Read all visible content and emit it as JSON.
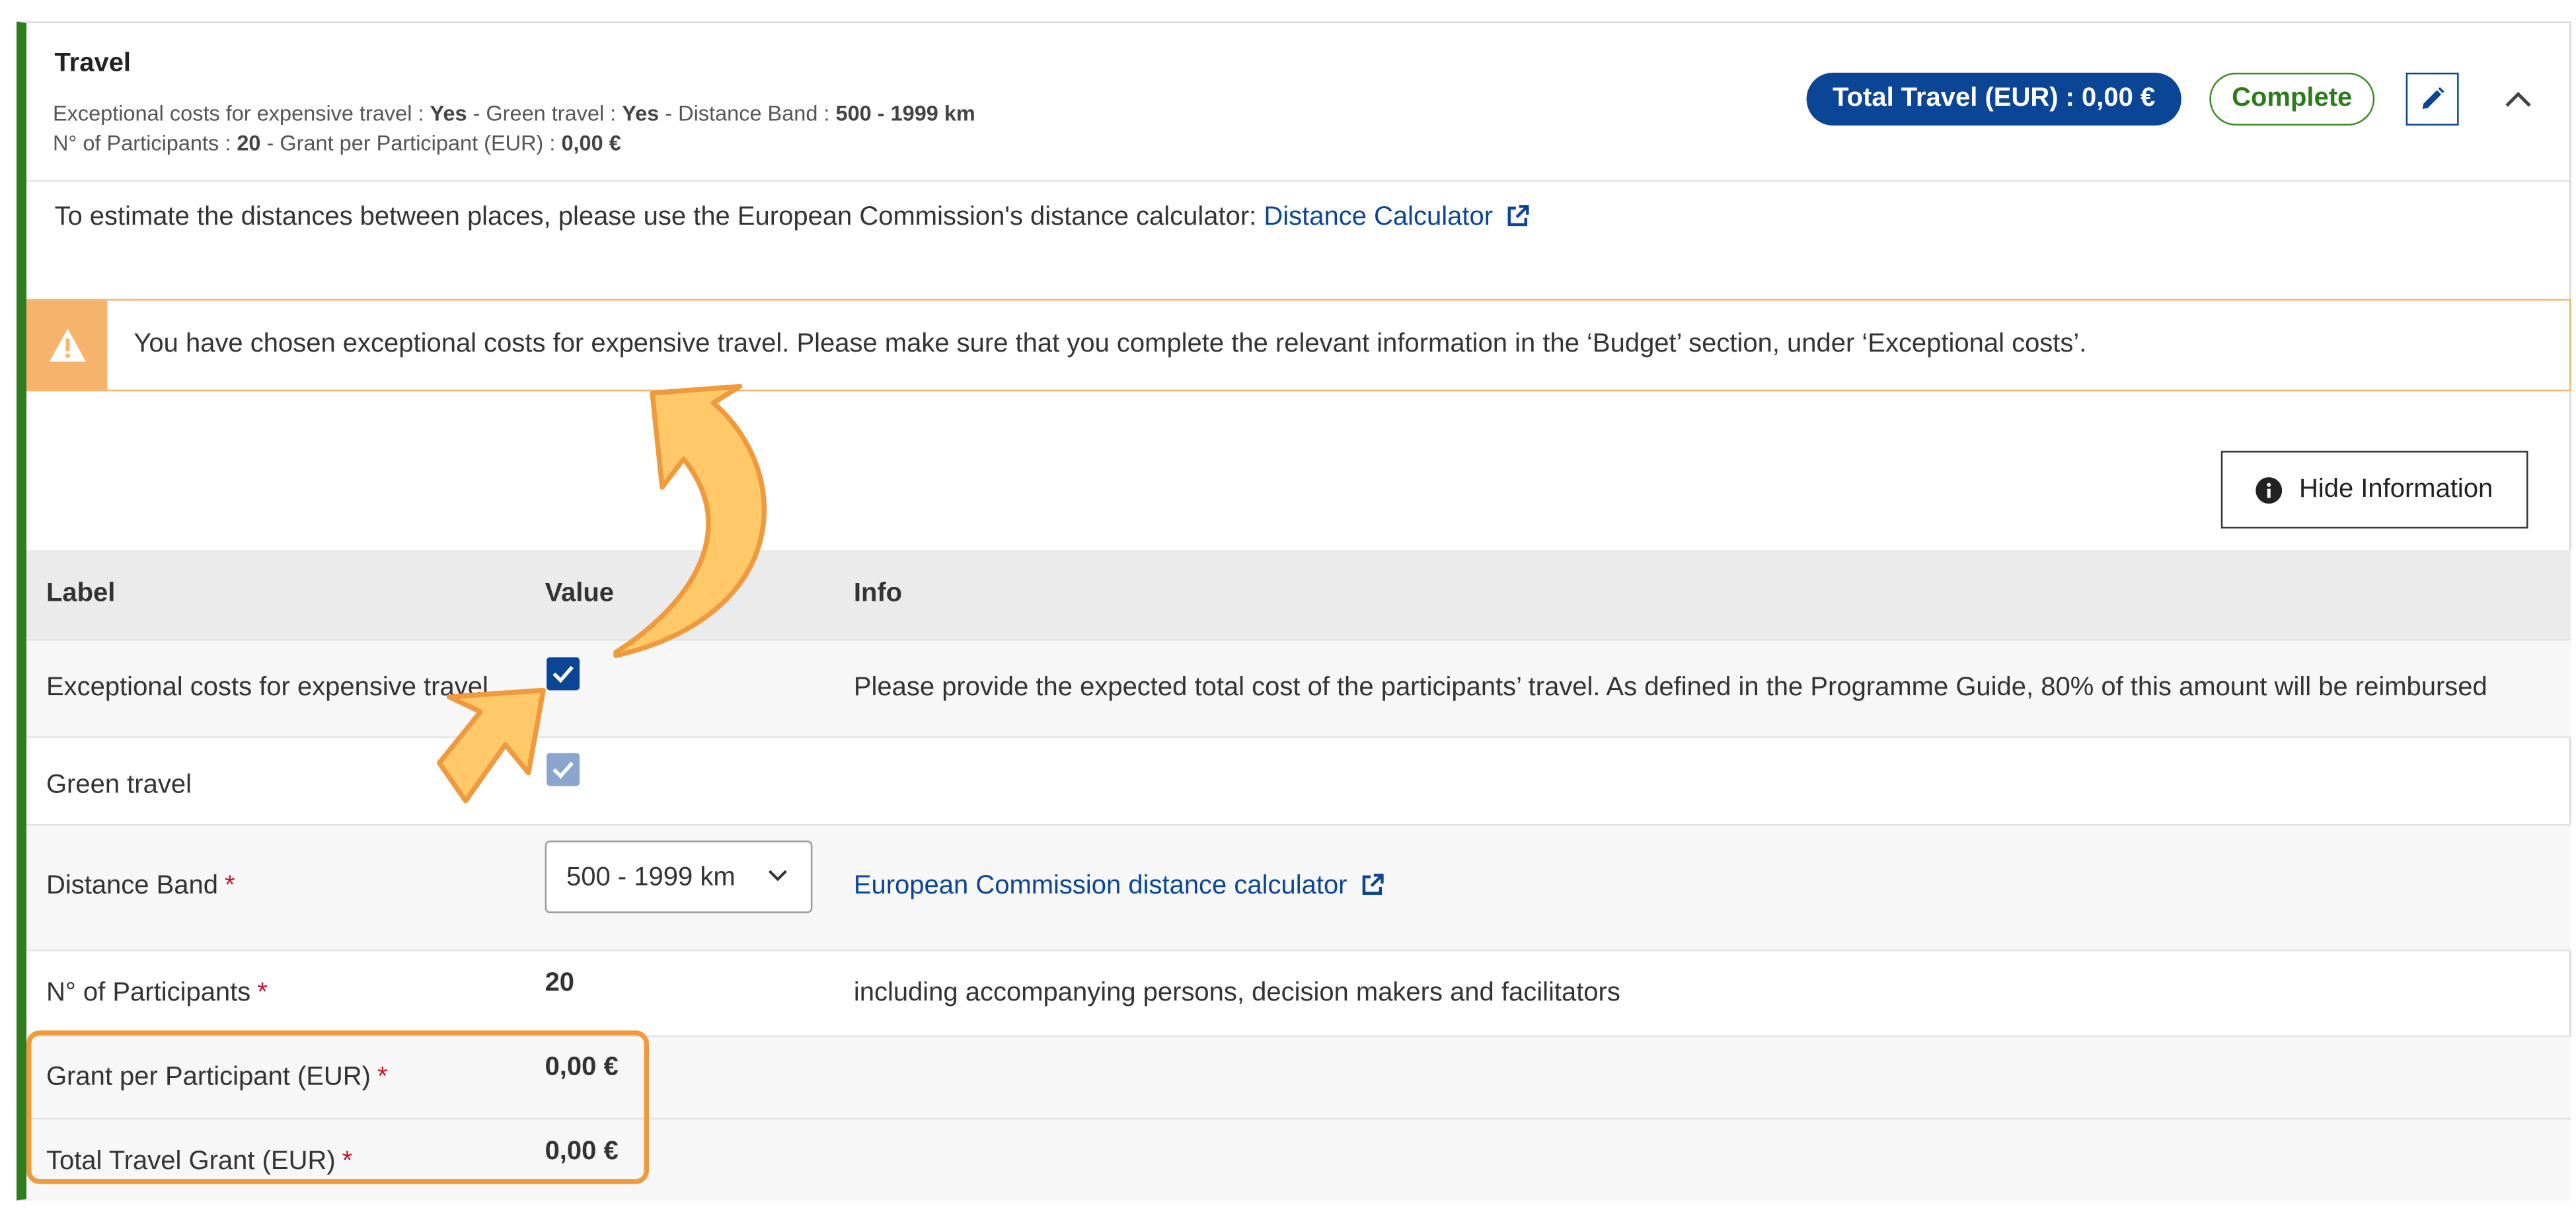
{
  "header": {
    "title": "Travel",
    "summary1": {
      "l1": "Exceptional costs for expensive travel : ",
      "v1": "Yes",
      "l2": " - Green travel : ",
      "v2": "Yes",
      "l3": " - Distance Band : ",
      "v3": "500 - 1999 km"
    },
    "summary2": {
      "l1": "N° of Participants : ",
      "v1": "20",
      "l2": " - Grant per Participant (EUR) : ",
      "v2": "0,00 €"
    },
    "total_pill": "Total Travel (EUR) : 0,00 €",
    "status_pill": "Complete",
    "edit_icon": "pencil-icon",
    "collapse_icon": "chevron-up-icon"
  },
  "distance": {
    "text": "To estimate the distances between places, please use the European Commission's distance calculator: ",
    "link": "Distance Calculator",
    "link_icon": "external-link-icon"
  },
  "alert": {
    "icon": "warning-icon",
    "text": "You have chosen exceptional costs for expensive travel. Please make sure that you complete the relevant information in the ‘Budget’ section, under ‘Exceptional costs’."
  },
  "hide_button": {
    "label": "Hide Information",
    "icon": "info-icon"
  },
  "table": {
    "headers": [
      "Label",
      "Value",
      "Info"
    ],
    "rows": [
      {
        "label": "Exceptional costs for expensive travel",
        "checked": true,
        "info": "Please provide the expected total cost of the participants’ travel. As defined in the Programme Guide, 80% of this amount will be reimbursed"
      },
      {
        "label": "Green travel",
        "checked": true,
        "disabled": true,
        "info": ""
      },
      {
        "label": "Distance Band",
        "required": "*",
        "value": "500 - 1999 km",
        "info_link": "European Commission distance calculator"
      },
      {
        "label": "N° of Participants",
        "required": "*",
        "value": "20",
        "info": "including accompanying persons, decision makers and facilitators"
      },
      {
        "label": "Grant per Participant (EUR)",
        "required": "*",
        "value": "0,00 €"
      },
      {
        "label": "Total Travel Grant (EUR)",
        "required": "*",
        "value": "0,00 €"
      }
    ]
  },
  "colors": {
    "primary": "#0b4596",
    "success": "#2e7b1c",
    "warning": "#f5b36b",
    "annotation": "#f09a3e",
    "required": "#c8102e"
  }
}
